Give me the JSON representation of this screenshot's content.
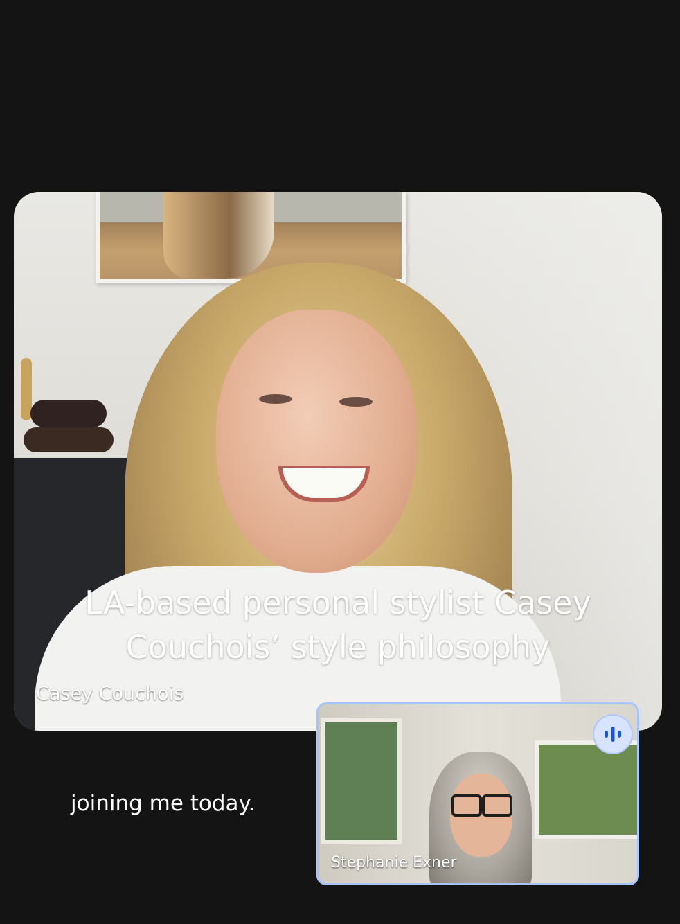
{
  "main_tile": {
    "participant_name": "Casey Couchois",
    "caption": "LA-based personal stylist Casey Couchois’ style philosophy"
  },
  "subtitle": {
    "text": "joining me today."
  },
  "pip_tile": {
    "participant_name": "Stephanie Exner",
    "speaking_icon": "audio-level-icon"
  },
  "colors": {
    "background": "#141414",
    "pip_border": "#a6c4ff",
    "speaking_badge": "#d7e3ff",
    "speaking_bars": "#1a57d6"
  }
}
